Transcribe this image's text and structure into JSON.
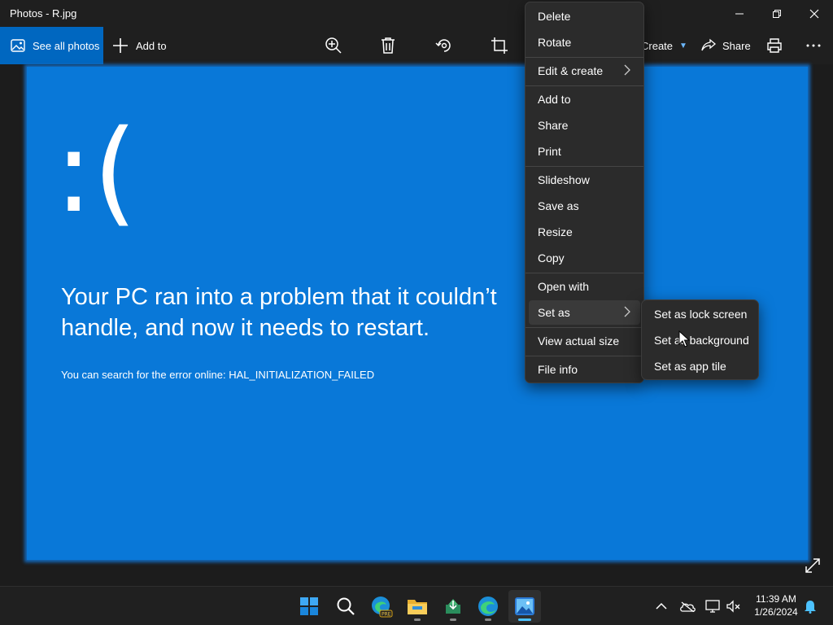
{
  "window": {
    "title": "Photos - R.jpg"
  },
  "toolbar": {
    "see_all_photos": "See all photos",
    "add_to": "Add to",
    "icons": [
      "zoom-in-icon",
      "delete-icon",
      "rotate-icon",
      "crop-icon",
      "print-icon",
      "more-icon"
    ],
    "create": "Create",
    "share": "Share"
  },
  "image": {
    "face": ":(",
    "message": "Your PC ran into a problem that it couldn’t handle, and now it needs to restart.",
    "error_line": "You can search for the error online: HAL_INITIALIZATION_FAILED",
    "background_color": "#0978d8"
  },
  "context_menu": {
    "items": [
      {
        "label": "Delete"
      },
      {
        "label": "Rotate"
      },
      {
        "label": "Edit & create"
      },
      {
        "label": "Add to"
      },
      {
        "label": "Share"
      },
      {
        "label": "Print"
      },
      {
        "label": "Slideshow"
      },
      {
        "label": "Save as"
      },
      {
        "label": "Resize"
      },
      {
        "label": "Copy"
      },
      {
        "label": "Open with"
      },
      {
        "label": "Set as"
      },
      {
        "label": "View actual size"
      },
      {
        "label": "File info"
      }
    ],
    "highlighted": "Set as"
  },
  "submenu": {
    "items": [
      {
        "label": "Set as lock screen"
      },
      {
        "label": "Set as background"
      },
      {
        "label": "Set as app tile"
      }
    ]
  },
  "taskbar": {
    "apps": [
      "start-icon",
      "search-icon",
      "edge-preview-icon",
      "file-explorer-icon",
      "app-installer-icon",
      "edge-icon",
      "photos-icon"
    ],
    "active_app": "photos-icon",
    "tray_icons": [
      "show-hidden-icons-chevron",
      "onedrive-icon",
      "network-icon",
      "volume-muted-icon",
      "notification-bell-icon"
    ],
    "time": "11:39 AM",
    "date": "1/26/2024"
  },
  "colors": {
    "accent": "#0067c0",
    "bsod_blue": "#0978d8",
    "chrome": "#1f1f1f"
  }
}
